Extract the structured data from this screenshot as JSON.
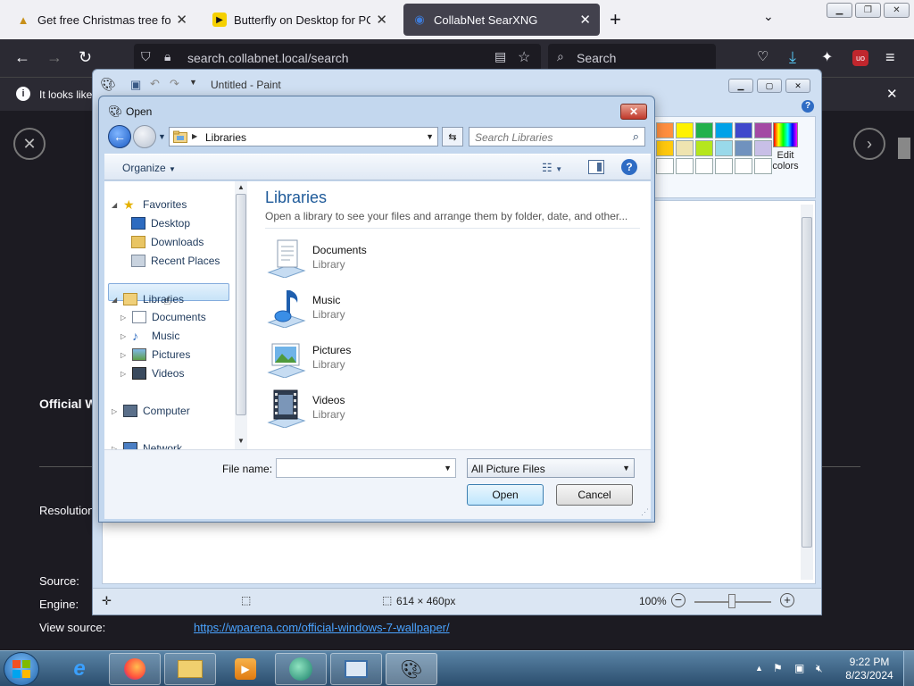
{
  "browser": {
    "tabs": [
      {
        "title": "Get free Christmas tree for your",
        "active": false
      },
      {
        "title": "Butterfly on Desktop for PC - D",
        "active": false
      },
      {
        "title": "CollabNet SearXNG",
        "active": true
      }
    ],
    "url": "search.collabnet.local/search",
    "search_placeholder": "Search",
    "notification_text": "It looks like"
  },
  "page": {
    "official_label": "Official W",
    "resolution_label": "Resolution",
    "source_label": "Source:",
    "engine_label": "Engine:",
    "view_source_label": "View source:",
    "view_source_link": "https://wparena.com/official-windows-7-wallpaper/"
  },
  "paint": {
    "title": "Untitled - Paint",
    "edit_colors_label_1": "Edit",
    "edit_colors_label_2": "colors",
    "palette": [
      "#ff8f40",
      "#fff200",
      "#22b14c",
      "#00a2e8",
      "#3f48cc",
      "#a349a4",
      "#ffc90e",
      "#efe4b0",
      "#b5e61d",
      "#99d9ea",
      "#7092be",
      "#c8bfe7",
      "#ffffff",
      "#ffffff",
      "#ffffff",
      "#ffffff",
      "#ffffff",
      "#ffffff"
    ],
    "canvas_size": "614 × 460px",
    "zoom": "100%"
  },
  "dialog": {
    "title": "Open",
    "address": "Libraries",
    "search_placeholder": "Search Libraries",
    "organize_label": "Organize",
    "nav": {
      "favorites": "Favorites",
      "desktop": "Desktop",
      "downloads": "Downloads",
      "recent_places": "Recent Places",
      "libraries": "Libraries",
      "documents": "Documents",
      "music": "Music",
      "pictures": "Pictures",
      "videos": "Videos",
      "computer": "Computer",
      "network": "Network"
    },
    "heading": "Libraries",
    "description": "Open a library to see your files and arrange them by folder, date, and other...",
    "libraries": [
      {
        "name": "Documents",
        "type": "Library"
      },
      {
        "name": "Music",
        "type": "Library"
      },
      {
        "name": "Pictures",
        "type": "Library"
      },
      {
        "name": "Videos",
        "type": "Library"
      }
    ],
    "file_name_label": "File name:",
    "file_name_value": "",
    "filter": "All Picture Files",
    "open_button": "Open",
    "cancel_button": "Cancel"
  },
  "taskbar": {
    "time": "9:22 PM",
    "date": "8/23/2024"
  }
}
